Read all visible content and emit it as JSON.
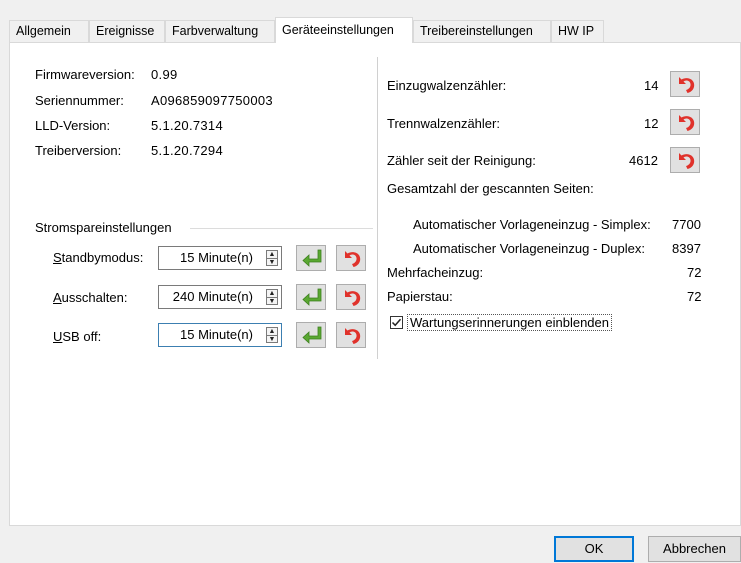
{
  "tabs": [
    "Allgemein",
    "Ereignisse",
    "Farbverwaltung",
    "Geräteeinstellungen",
    "Treibereinstellungen",
    "HW IP"
  ],
  "active_tab": "Geräteeinstellungen",
  "info": {
    "firmware_label": "Firmwareversion:",
    "firmware_value": "0.99",
    "serial_label": "Seriennummer:",
    "serial_value": "A096859097750003",
    "lld_label": "LLD-Version:",
    "lld_value": "5.1.20.7314",
    "driver_label": "Treiberversion:",
    "driver_value": "5.1.20.7294"
  },
  "power": {
    "group_title": "Stromspareinstellungen",
    "standby_label_u": "S",
    "standby_label_rest": "tandbymodus:",
    "standby_value": "15 Minute(n)",
    "off_label_u": "A",
    "off_label_rest": "usschalten:",
    "off_value": "240 Minute(n)",
    "usb_label_u": "U",
    "usb_label_rest": "SB off:",
    "usb_value": "15 Minute(n)"
  },
  "counters": {
    "feed_roller_label": "Einzugwalzenzähler:",
    "feed_roller_value": "14",
    "separation_roller_label": "Trennwalzenzähler:",
    "separation_roller_value": "12",
    "since_cleaning_label": "Zähler seit der Reinigung:",
    "since_cleaning_value": "4612",
    "total_pages_label": "Gesamtzahl der gescannten Seiten:",
    "adf_simplex_label": "Automatischer Vorlageneinzug - Simplex:",
    "adf_simplex_value": "7700",
    "adf_duplex_label": "Automatischer Vorlageneinzug - Duplex:",
    "adf_duplex_value": "8397",
    "multifeed_label": "Mehrfacheinzug:",
    "multifeed_value": "72",
    "paper_jam_label": "Papierstau:",
    "paper_jam_value": "72",
    "maintenance_checkbox_label": "Wartungserinnerungen einblenden",
    "maintenance_checked": true
  },
  "footer": {
    "ok_label": "OK",
    "cancel_label": "Abbrechen"
  },
  "colors": {
    "reset_icon": "#e0322b",
    "apply_icon": "#5aa832",
    "focus_border": "#0078d7"
  }
}
